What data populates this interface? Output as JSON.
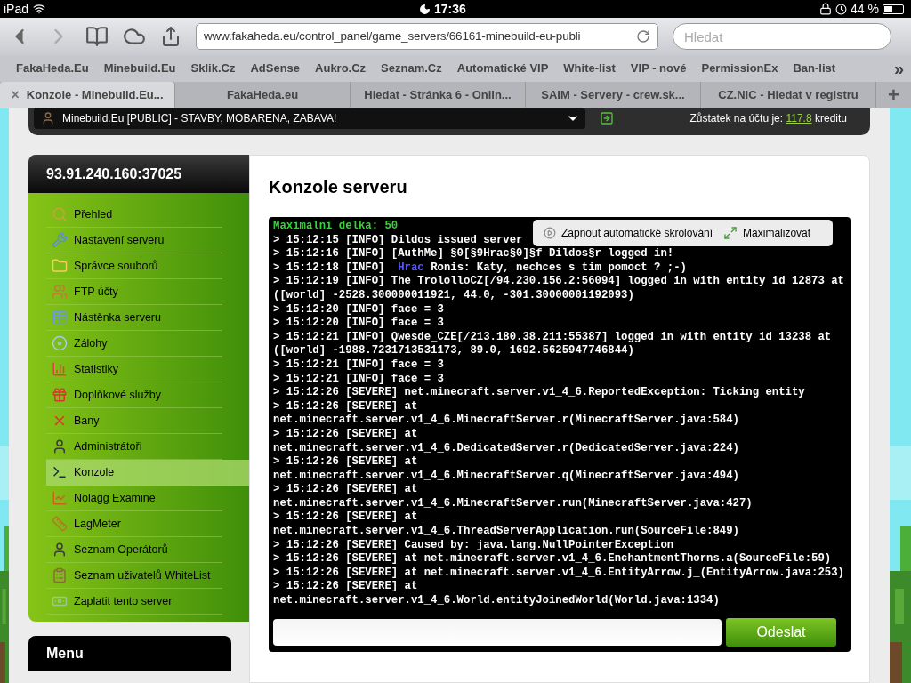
{
  "status_bar": {
    "device": "iPad",
    "time": "17:36",
    "battery": "44 %"
  },
  "browser": {
    "url": "www.fakaheda.eu/control_panel/game_servers/66161-minebuild-eu-publi",
    "search_placeholder": "Hledat",
    "bookmarks": [
      "FakaHeda.Eu",
      "Minebuild.Eu",
      "Sklik.Cz",
      "AdSense",
      "Aukro.Cz",
      "Seznam.Cz",
      "Automatické VIP",
      "White-list",
      "VIP - nové",
      "PermissionEx",
      "Ban-list"
    ],
    "bookmarks_more": "»",
    "tabs": [
      {
        "label": "Konzole - Minebuild.Eu...",
        "selected": true
      },
      {
        "label": "FakaHeda.eu",
        "selected": false
      },
      {
        "label": "Hledat - Stránka 6 - Onlin...",
        "selected": false
      },
      {
        "label": "SAIM - Servery - crew.sk...",
        "selected": false
      },
      {
        "label": "CZ.NIC - Hledat v registru",
        "selected": false
      }
    ],
    "tab_close": "×",
    "new_tab": "+"
  },
  "header": {
    "server_select": "Minebuild.Eu [PUBLIC] - STAVBY, MOBARENA, ZABAVA!",
    "balance_label": "Zůstatek na účtu je:",
    "balance_value": "117.8",
    "balance_unit": "kreditu"
  },
  "sidebar": {
    "address": "93.91.240.160:37025",
    "items": [
      {
        "label": "Přehled",
        "selected": false
      },
      {
        "label": "Nastavení serveru",
        "selected": false
      },
      {
        "label": "Správce souborů",
        "selected": false
      },
      {
        "label": "FTP účty",
        "selected": false
      },
      {
        "label": "Nástěnka serveru",
        "selected": false
      },
      {
        "label": "Zálohy",
        "selected": false
      },
      {
        "label": "Statistiky",
        "selected": false
      },
      {
        "label": "Doplňkové služby",
        "selected": false
      },
      {
        "label": "Bany",
        "selected": false
      },
      {
        "label": "Administrátoři",
        "selected": false
      },
      {
        "label": "Konzole",
        "selected": true
      },
      {
        "label": "Nolagg Examine",
        "selected": false
      },
      {
        "label": "LagMeter",
        "selected": false
      },
      {
        "label": "Seznam Operátorů",
        "selected": false
      },
      {
        "label": "Seznam uživatelů WhiteList",
        "selected": false
      },
      {
        "label": "Zaplatit tento server",
        "selected": false
      }
    ],
    "menu_title": "Menu"
  },
  "console": {
    "title": "Konzole serveru",
    "overlay": {
      "autoscroll": "Zapnout automatické skrolování",
      "maximize": "Maximalizovat"
    },
    "lines": [
      {
        "kind": "notice",
        "text": "Maximalni delka: 50"
      },
      {
        "kind": "log",
        "text": "> 15:12:15 [INFO] Dildos issued server"
      },
      {
        "kind": "log",
        "text": "> 15:12:16 [INFO] [AuthMe] §0[§9Hrac§0]§f Dildos§r logged in!"
      },
      {
        "kind": "chat",
        "prefix": "> 15:12:18 [INFO] ",
        "rank": "Hrac",
        "text": "Ronis: Katy, nechces s tim pomoct ? ;-)"
      },
      {
        "kind": "log",
        "text": "> 15:12:19 [INFO] The_TrololloCZ[/94.230.156.2:56094] logged in with entity id 12873 at ([world] -2528.300000011921, 44.0, -301.30000001192093)"
      },
      {
        "kind": "log",
        "text": "> 15:12:20 [INFO] face = 3"
      },
      {
        "kind": "log",
        "text": "> 15:12:20 [INFO] face = 3"
      },
      {
        "kind": "log",
        "text": "> 15:12:21 [INFO] Qwesde_CZE[/213.180.38.211:55387] logged in with entity id 13238 at ([world] -1988.7231713531173, 89.0, 1692.5625947746844)"
      },
      {
        "kind": "log",
        "text": "> 15:12:21 [INFO] face = 3"
      },
      {
        "kind": "log",
        "text": "> 15:12:21 [INFO] face = 3"
      },
      {
        "kind": "log",
        "text": "> 15:12:26 [SEVERE] net.minecraft.server.v1_4_6.ReportedException: Ticking entity"
      },
      {
        "kind": "log",
        "text": "> 15:12:26 [SEVERE] at net.minecraft.server.v1_4_6.MinecraftServer.r(MinecraftServer.java:584)"
      },
      {
        "kind": "log",
        "text": "> 15:12:26 [SEVERE] at net.minecraft.server.v1_4_6.DedicatedServer.r(DedicatedServer.java:224)"
      },
      {
        "kind": "log",
        "text": "> 15:12:26 [SEVERE] at net.minecraft.server.v1_4_6.MinecraftServer.q(MinecraftServer.java:494)"
      },
      {
        "kind": "log",
        "text": "> 15:12:26 [SEVERE] at net.minecraft.server.v1_4_6.MinecraftServer.run(MinecraftServer.java:427)"
      },
      {
        "kind": "log",
        "text": "> 15:12:26 [SEVERE] at net.minecraft.server.v1_4_6.ThreadServerApplication.run(SourceFile:849)"
      },
      {
        "kind": "log",
        "text": "> 15:12:26 [SEVERE] Caused by: java.lang.NullPointerException"
      },
      {
        "kind": "log",
        "text": "> 15:12:26 [SEVERE] at net.minecraft.server.v1_4_6.EnchantmentThorns.a(SourceFile:59)"
      },
      {
        "kind": "log",
        "text": "> 15:12:26 [SEVERE] at net.minecraft.server.v1_4_6.EntityArrow.j_(EntityArrow.java:253)"
      },
      {
        "kind": "log",
        "text": "> 15:12:26 [SEVERE] at net.minecraft.server.v1_4_6.World.entityJoinedWorld(World.java:1334)"
      }
    ],
    "send_button": "Odeslat"
  }
}
